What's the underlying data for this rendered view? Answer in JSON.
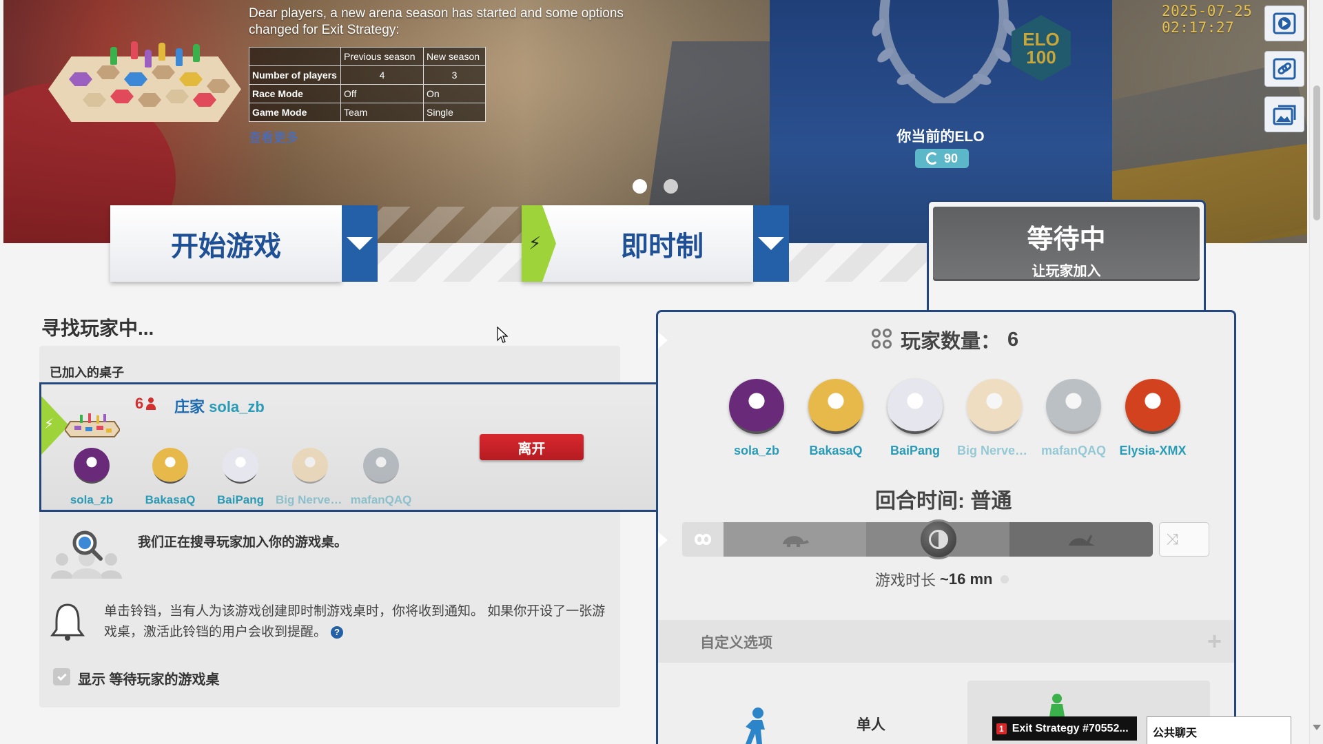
{
  "banner": {
    "news_line1": "Dear players, a new arena season has started and some options",
    "news_line2": "changed for Exit Strategy:",
    "table": {
      "headers": [
        "",
        "Previous season",
        "New season"
      ],
      "rows": [
        [
          "Number of players",
          "4",
          "3"
        ],
        [
          "Race Mode",
          "Off",
          "On"
        ],
        [
          "Game Mode",
          "Team",
          "Single"
        ]
      ]
    },
    "see_more": "查看更多",
    "elo_badge_top": "ELO",
    "elo_badge_bottom": "100",
    "elo_title": "你当前的ELO",
    "elo_value": "90",
    "timestamp": "2025-07-25 02:17:27",
    "slide_count": 2,
    "active_slide": 1
  },
  "actions": {
    "start_label": "开始游戏",
    "mode_label": "即时制",
    "waiting_title": "等待中",
    "waiting_sub": "让玩家加入"
  },
  "lobby": {
    "finding_title": "寻找玩家中...",
    "joined_tables_label": "已加入的桌子",
    "table": {
      "player_count": "6",
      "host_prefix": "庄家",
      "host_name": "sola_zb",
      "leave_label": "离开",
      "players": [
        {
          "name": "sola_zb",
          "faded": false,
          "color": "#6a2a7a"
        },
        {
          "name": "BakasaQ",
          "faded": false,
          "color": "#e7b94a"
        },
        {
          "name": "BaiPang",
          "faded": false,
          "color": "#e6e6ee"
        },
        {
          "name": "Big Nerves...",
          "faded": true,
          "color": "#f0c98a"
        },
        {
          "name": "mafanQAQ",
          "faded": true,
          "color": "#7d8894"
        }
      ]
    },
    "searching_text": "我们正在搜寻玩家加入你的游戏桌。",
    "bell_text": "单击铃铛，当有人为该游戏创建即时制游戏桌时，你将收到通知。 如果你开设了一张游戏桌，激活此铃铛的用户会收到提醒。",
    "help_mark": "?",
    "show_waiting_label": "显示 等待玩家的游戏桌",
    "show_waiting_checked": true
  },
  "settings": {
    "player_count_label": "玩家数量：",
    "player_count_value": "6",
    "players": [
      {
        "name": "sola_zb",
        "faded": false,
        "color": "#6a2a7a"
      },
      {
        "name": "BakasaQ",
        "faded": false,
        "color": "#e7b94a"
      },
      {
        "name": "BaiPang",
        "faded": false,
        "color": "#e6e6ee"
      },
      {
        "name": "Big Nerves ...",
        "faded": true,
        "color": "#f0c98a"
      },
      {
        "name": "mafanQAQ",
        "faded": true,
        "color": "#7d8894"
      },
      {
        "name": "Elysia-XMX",
        "faded": false,
        "color": "#d2421f"
      }
    ],
    "round_time_label": "回合时间: 普通",
    "duration_label": "游戏时长",
    "duration_value": "~16 mn",
    "custom_options_label": "自定义选项",
    "custom_plus": "+",
    "solo_label": "单人"
  },
  "footer": {
    "notification_badge": "1",
    "notification_label": "Exit Strategy #70552...",
    "chat_tab_label": "公共聊天"
  },
  "colors": {
    "brand_blue": "#2460a7",
    "dark_navy": "#24467f",
    "lightning_green": "#9fd33a",
    "danger_red": "#d9272e",
    "player_name": "#2a9bb6"
  }
}
